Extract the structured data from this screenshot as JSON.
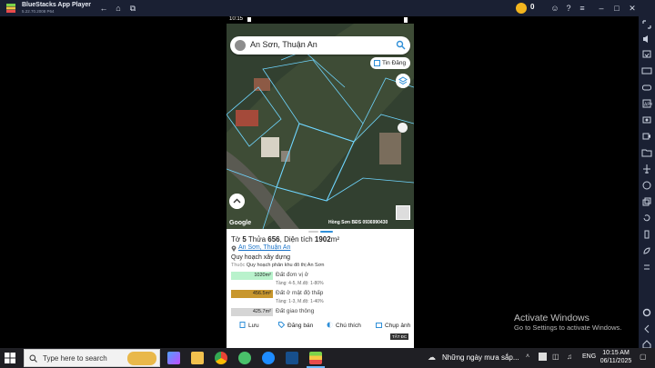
{
  "window": {
    "title": "BlueStacks App Player",
    "version": "5.22.70.2008  P64",
    "coins": "0"
  },
  "phone": {
    "time": "10:15",
    "search": {
      "value": "An Sơn, Thuận An"
    },
    "tin_dang_label": "Tin Đăng",
    "map_provider": "Google",
    "watermark": "Hồng Sơn BĐS 0936990430",
    "parcel": {
      "prefix": "Tờ ",
      "sheet": "5",
      "mid": " Thửa ",
      "lot": "656",
      "area_label": ", Diện tích ",
      "area": "1902",
      "area_unit": "m²",
      "address": "An Sơn, Thuận An"
    },
    "planning": {
      "title": "Quy hoạch xây dựng",
      "sub_prefix": "Thuộc",
      "sub": "Quy hoạch phân khu đô thị An Sơn",
      "zones": [
        {
          "area": "1020m²",
          "name": "Đất đơn vị ở",
          "detail": "Tầng: 4-5, M.độ: 1-80%",
          "color": "#b9f2cc"
        },
        {
          "area": "456.5m²",
          "name": "Đất ở mật độ thấp",
          "detail": "Tầng: 1-3, M.độ: 1-40%",
          "color": "#c8972e"
        },
        {
          "area": "425.7m²",
          "name": "Đất giao thông",
          "detail": "",
          "color": "#d5d5d5"
        }
      ]
    },
    "actions": {
      "save": "Lưu",
      "post": "Đăng bán",
      "note": "Chú thích",
      "capture": "Chụp ảnh"
    },
    "badge_corner": "TẤT ĐC"
  },
  "windows_activation": {
    "title": "Activate Windows",
    "subtitle": "Go to Settings to activate Windows."
  },
  "taskbar": {
    "search_placeholder": "Type here to search",
    "weather": "Những ngày mưa sắp...",
    "language": "ENG",
    "time": "10:15 AM",
    "date": "06/11/2025"
  },
  "colors": {
    "titlebar": "#1a2033",
    "taskbar": "#1f1f24",
    "link": "#1a73c8",
    "map_parcel_outline": "#6fd6ff"
  }
}
